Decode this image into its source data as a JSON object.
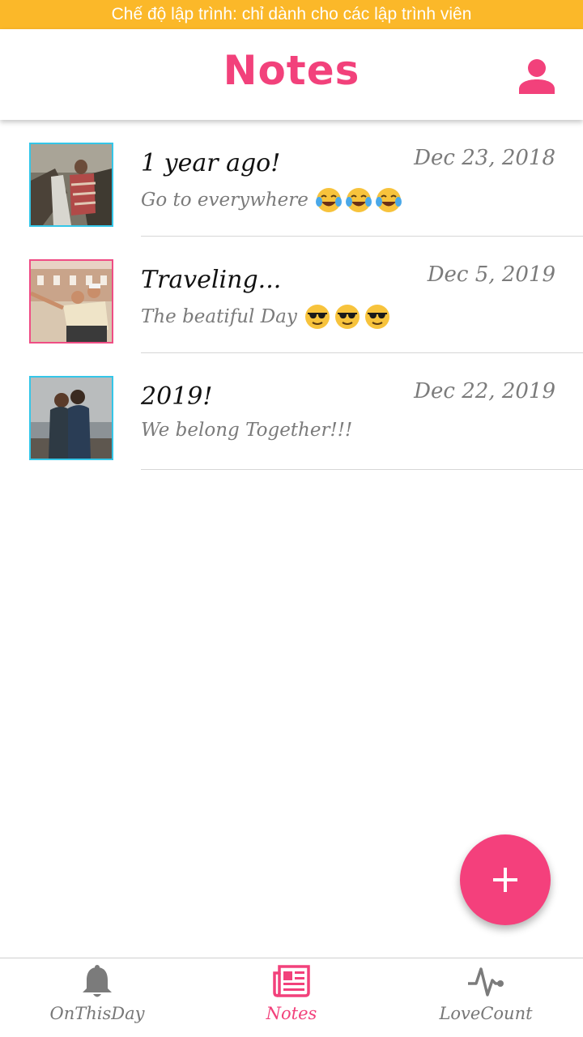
{
  "banner": {
    "text": "Chế độ lập trình: chỉ dành cho các lập trình viên"
  },
  "header": {
    "title": "Notes"
  },
  "colors": {
    "accent": "#f2417b",
    "banner": "#fbb829",
    "thumb_border_blue": "#34c6e8",
    "thumb_border_pink": "#ef4d85"
  },
  "notes": [
    {
      "title": "1 year ago!",
      "date": "Dec 23, 2018",
      "snippet": "Go to everywhere",
      "emoji": "face-with-tears-of-joy",
      "emoji_count": 3,
      "thumb_icon": "photo-person-waterfall"
    },
    {
      "title": "Traveling...",
      "date": "Dec 5, 2019",
      "snippet": "The beatiful Day",
      "emoji": "smiling-face-with-sunglasses",
      "emoji_count": 3,
      "thumb_icon": "photo-couple-map"
    },
    {
      "title": "2019!",
      "date": "Dec 22, 2019",
      "snippet": "We belong Together!!!",
      "thumb_icon": "photo-couple-beach"
    }
  ],
  "fab": {
    "icon": "plus-icon"
  },
  "bottom_nav": {
    "tabs": [
      {
        "label": "OnThisDay",
        "icon": "bell-icon"
      },
      {
        "label": "Notes",
        "icon": "newspaper-icon",
        "active": true
      },
      {
        "label": "LoveCount",
        "icon": "heartbeat-icon"
      }
    ]
  }
}
